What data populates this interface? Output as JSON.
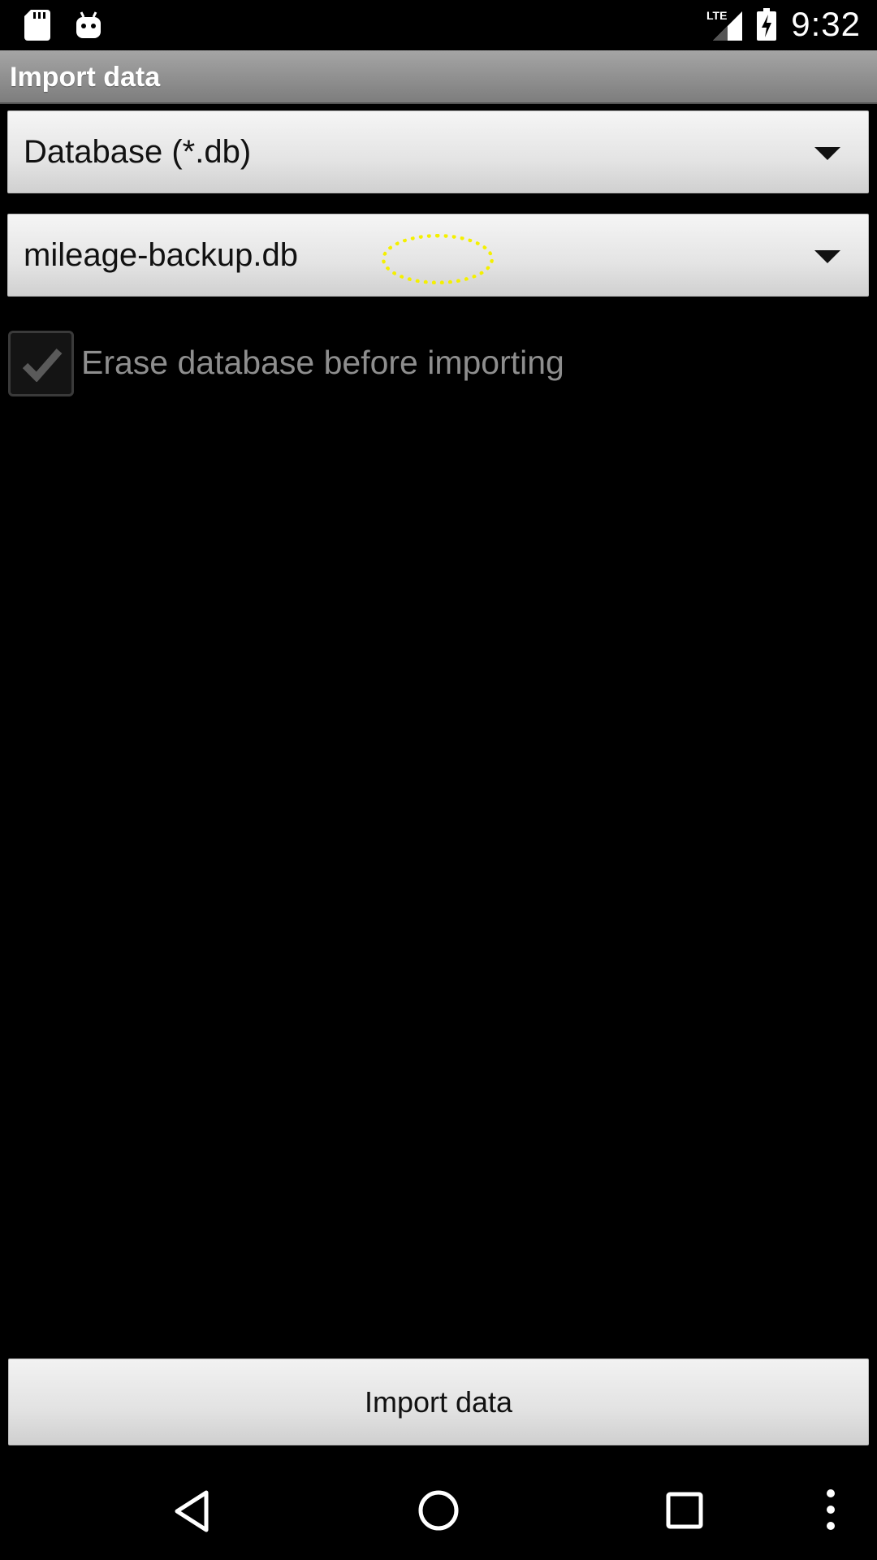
{
  "status_bar": {
    "clock": "9:32",
    "network_label": "LTE",
    "left_icons": [
      "sd-card-icon",
      "android-debug-icon"
    ],
    "right_icons": [
      "signal-icon",
      "battery-charging-icon"
    ]
  },
  "title_bar": {
    "title": "Import data"
  },
  "format_spinner": {
    "selected": "Database (*.db)"
  },
  "file_spinner": {
    "selected": "mileage-backup.db"
  },
  "erase_option": {
    "label": "Erase database before importing",
    "checked": true,
    "enabled": false
  },
  "import_button": {
    "label": "Import data"
  },
  "nav_bar": {
    "buttons": [
      "back-icon",
      "home-icon",
      "recents-icon",
      "overflow-menu-icon"
    ]
  },
  "colors": {
    "background": "#000000",
    "title_bar": "#8f8f8f",
    "tap_indicator": "#f4f000",
    "disabled_text": "#8e8e8e"
  }
}
